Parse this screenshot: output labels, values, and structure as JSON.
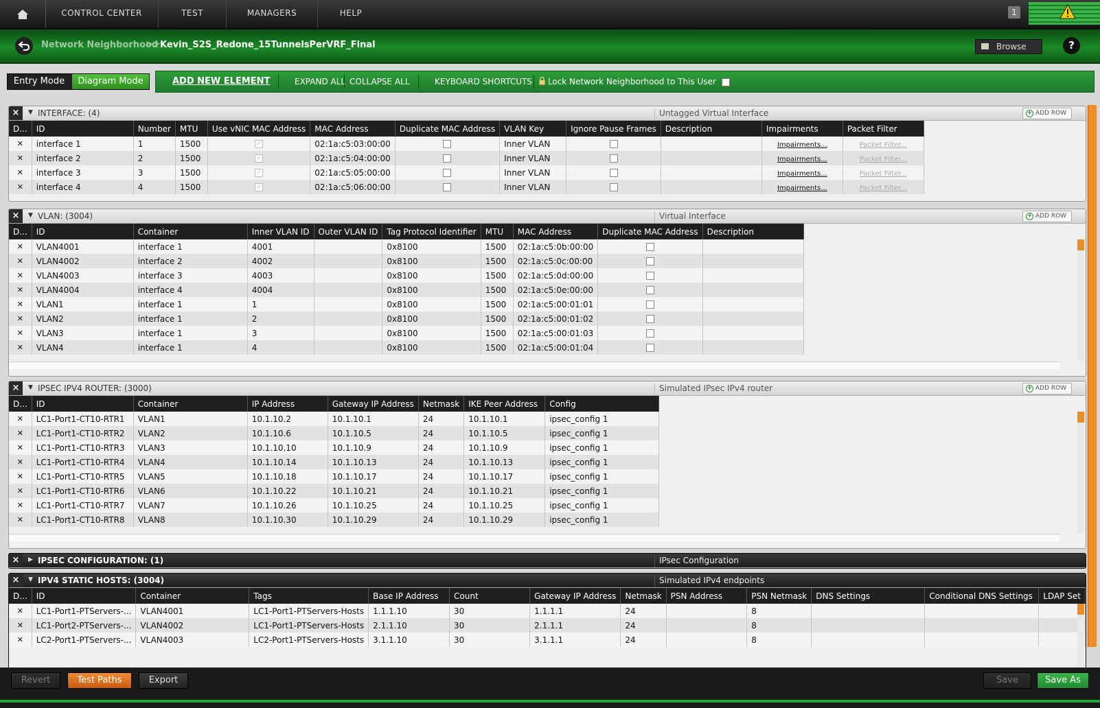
{
  "nav": {
    "items": [
      "CONTROL CENTER",
      "TEST",
      "MANAGERS",
      "HELP"
    ],
    "badge": "1"
  },
  "crumbs": {
    "parent": "Network Neighborhood",
    "separator": ">>",
    "current": "Kevin_S2S_Redone_15TunnelsPerVRF_Final",
    "browse_label": "Browse",
    "help_label": "?"
  },
  "toolbar": {
    "entry_mode": "Entry Mode",
    "diagram_mode": "Diagram Mode",
    "add_new": "ADD NEW ELEMENT",
    "expand_all": "EXPAND ALL",
    "collapse_all": "COLLAPSE ALL",
    "keyboard_shortcuts": "KEYBOARD SHORTCUTS",
    "lock_label": "Lock Network Neighborhood to This User"
  },
  "add_row_label": "ADD ROW",
  "interface": {
    "title": "INTERFACE: (4)",
    "description": "Untagged Virtual Interface",
    "columns": [
      "D...",
      "ID",
      "Number",
      "MTU",
      "Use vNIC MAC Address",
      "MAC Address",
      "Duplicate MAC Address",
      "VLAN Key",
      "Ignore Pause Frames",
      "Description",
      "Impairments",
      "Packet Filter"
    ],
    "impairments_link": "Impairments...",
    "packet_filter_link": "Packet Filter...",
    "rows": [
      {
        "id": "interface 1",
        "number": "1",
        "mtu": "1500",
        "mac": "02:1a:c5:03:00:00",
        "vlan_key": "Inner VLAN"
      },
      {
        "id": "interface 2",
        "number": "2",
        "mtu": "1500",
        "mac": "02:1a:c5:04:00:00",
        "vlan_key": "Inner VLAN"
      },
      {
        "id": "interface 3",
        "number": "3",
        "mtu": "1500",
        "mac": "02:1a:c5:05:00:00",
        "vlan_key": "Inner VLAN"
      },
      {
        "id": "interface 4",
        "number": "4",
        "mtu": "1500",
        "mac": "02:1a:c5:06:00:00",
        "vlan_key": "Inner VLAN"
      }
    ]
  },
  "vlan": {
    "title": "VLAN: (3004)",
    "description": "Virtual Interface",
    "columns": [
      "D...",
      "ID",
      "Container",
      "Inner VLAN ID",
      "Outer VLAN ID",
      "Tag Protocol Identifier",
      "MTU",
      "MAC Address",
      "Duplicate MAC Address",
      "Description"
    ],
    "rows": [
      {
        "id": "VLAN4001",
        "container": "interface 1",
        "inner": "4001",
        "outer": "",
        "tpid": "0x8100",
        "mtu": "1500",
        "mac": "02:1a:c5:0b:00:00"
      },
      {
        "id": "VLAN4002",
        "container": "interface 2",
        "inner": "4002",
        "outer": "",
        "tpid": "0x8100",
        "mtu": "1500",
        "mac": "02:1a:c5:0c:00:00"
      },
      {
        "id": "VLAN4003",
        "container": "interface 3",
        "inner": "4003",
        "outer": "",
        "tpid": "0x8100",
        "mtu": "1500",
        "mac": "02:1a:c5:0d:00:00"
      },
      {
        "id": "VLAN4004",
        "container": "interface 4",
        "inner": "4004",
        "outer": "",
        "tpid": "0x8100",
        "mtu": "1500",
        "mac": "02:1a:c5:0e:00:00"
      },
      {
        "id": "VLAN1",
        "container": "interface 1",
        "inner": "1",
        "outer": "",
        "tpid": "0x8100",
        "mtu": "1500",
        "mac": "02:1a:c5:00:01:01"
      },
      {
        "id": "VLAN2",
        "container": "interface 1",
        "inner": "2",
        "outer": "",
        "tpid": "0x8100",
        "mtu": "1500",
        "mac": "02:1a:c5:00:01:02"
      },
      {
        "id": "VLAN3",
        "container": "interface 1",
        "inner": "3",
        "outer": "",
        "tpid": "0x8100",
        "mtu": "1500",
        "mac": "02:1a:c5:00:01:03"
      },
      {
        "id": "VLAN4",
        "container": "interface 1",
        "inner": "4",
        "outer": "",
        "tpid": "0x8100",
        "mtu": "1500",
        "mac": "02:1a:c5:00:01:04"
      }
    ]
  },
  "ipsec_router": {
    "title": "IPSEC IPV4 ROUTER: (3000)",
    "description": "Simulated IPsec IPv4 router",
    "columns": [
      "D...",
      "ID",
      "Container",
      "IP Address",
      "Gateway IP Address",
      "Netmask",
      "IKE Peer Address",
      "Config"
    ],
    "rows": [
      {
        "id": "LC1-Port1-CT10-RTR1",
        "container": "VLAN1",
        "ip": "10.1.10.2",
        "gw": "10.1.10.1",
        "mask": "24",
        "ike": "10.1.10.1",
        "config": "ipsec_config 1"
      },
      {
        "id": "LC1-Port1-CT10-RTR2",
        "container": "VLAN2",
        "ip": "10.1.10.6",
        "gw": "10.1.10.5",
        "mask": "24",
        "ike": "10.1.10.5",
        "config": "ipsec_config 1"
      },
      {
        "id": "LC1-Port1-CT10-RTR3",
        "container": "VLAN3",
        "ip": "10.1.10.10",
        "gw": "10.1.10.9",
        "mask": "24",
        "ike": "10.1.10.9",
        "config": "ipsec_config 1"
      },
      {
        "id": "LC1-Port1-CT10-RTR4",
        "container": "VLAN4",
        "ip": "10.1.10.14",
        "gw": "10.1.10.13",
        "mask": "24",
        "ike": "10.1.10.13",
        "config": "ipsec_config 1"
      },
      {
        "id": "LC1-Port1-CT10-RTR5",
        "container": "VLAN5",
        "ip": "10.1.10.18",
        "gw": "10.1.10.17",
        "mask": "24",
        "ike": "10.1.10.17",
        "config": "ipsec_config 1"
      },
      {
        "id": "LC1-Port1-CT10-RTR6",
        "container": "VLAN6",
        "ip": "10.1.10.22",
        "gw": "10.1.10.21",
        "mask": "24",
        "ike": "10.1.10.21",
        "config": "ipsec_config 1"
      },
      {
        "id": "LC1-Port1-CT10-RTR7",
        "container": "VLAN7",
        "ip": "10.1.10.26",
        "gw": "10.1.10.25",
        "mask": "24",
        "ike": "10.1.10.25",
        "config": "ipsec_config 1"
      },
      {
        "id": "LC1-Port1-CT10-RTR8",
        "container": "VLAN8",
        "ip": "10.1.10.30",
        "gw": "10.1.10.29",
        "mask": "24",
        "ike": "10.1.10.29",
        "config": "ipsec_config 1"
      }
    ]
  },
  "ipsec_config": {
    "title": "IPSEC CONFIGURATION: (1)",
    "description": "IPsec Configuration"
  },
  "static_hosts": {
    "title": "IPV4 STATIC HOSTS: (3004)",
    "description": "Simulated IPv4 endpoints",
    "columns": [
      "D...",
      "ID",
      "Container",
      "Tags",
      "Base IP Address",
      "Count",
      "Gateway IP Address",
      "Netmask",
      "PSN Address",
      "PSN Netmask",
      "DNS Settings",
      "Conditional DNS Settings",
      "LDAP Set"
    ],
    "rows": [
      {
        "id": "LC1-Port1-PTServers-...",
        "container": "VLAN4001",
        "tags": "LC1-Port1-PTServers-Hosts",
        "base_ip": "1.1.1.10",
        "count": "30",
        "gw": "1.1.1.1",
        "mask": "24",
        "psn": "",
        "psn_mask": "8"
      },
      {
        "id": "LC1-Port2-PTServers-...",
        "container": "VLAN4002",
        "tags": "LC1-Port1-PTServers-Hosts",
        "base_ip": "2.1.1.10",
        "count": "30",
        "gw": "2.1.1.1",
        "mask": "24",
        "psn": "",
        "psn_mask": "8"
      },
      {
        "id": "LC2-Port1-PTServers-...",
        "container": "VLAN4003",
        "tags": "LC2-Port1-PTServers-Hosts",
        "base_ip": "3.1.1.10",
        "count": "30",
        "gw": "3.1.1.1",
        "mask": "24",
        "psn": "",
        "psn_mask": "8"
      }
    ]
  },
  "bottom": {
    "revert": "Revert",
    "test_paths": "Test Paths",
    "export": "Export",
    "save": "Save",
    "save_as": "Save As"
  },
  "colors": {
    "accent_green": "#1e8a2e",
    "accent_orange": "#e98c2a",
    "header_dark": "#1f1f1f"
  }
}
